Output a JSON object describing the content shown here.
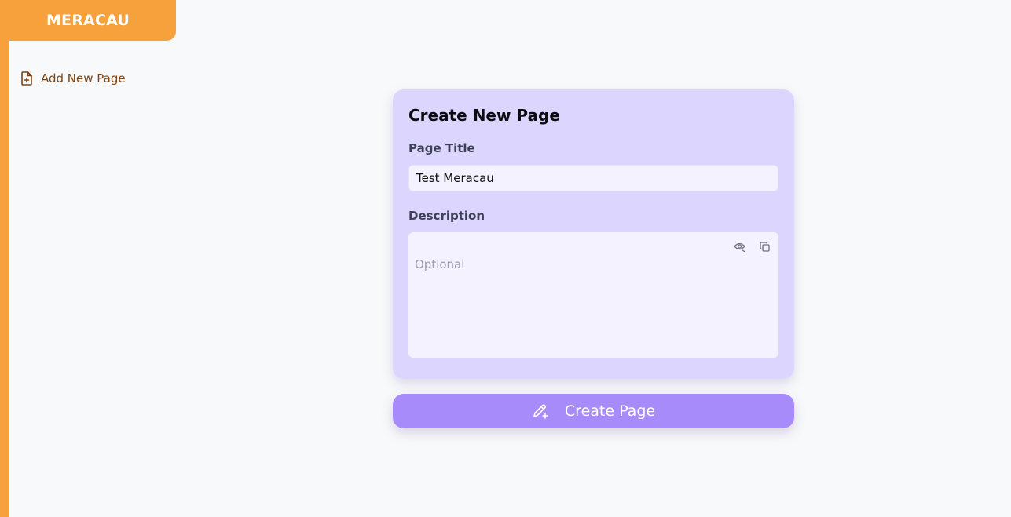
{
  "brand": {
    "name": "MERACAU",
    "color": "#f6a13c"
  },
  "sidebar": {
    "items": [
      {
        "label": "Add New Page",
        "icon": "file-plus-icon"
      }
    ]
  },
  "form": {
    "title": "Create New Page",
    "page_title_label": "Page Title",
    "page_title_value": "Test Meracau",
    "description_label": "Description",
    "description_placeholder": "Optional",
    "description_value": "",
    "tools": [
      {
        "icon": "eye-icon"
      },
      {
        "icon": "copy-icon"
      }
    ]
  },
  "submit": {
    "label": "Create Page",
    "icon": "pencil-plus-icon",
    "color": "#a78bfa"
  },
  "colors": {
    "card_bg": "#dcd6fe",
    "input_bg": "#f4f2fe",
    "sidebar_label": "#7a4416"
  }
}
